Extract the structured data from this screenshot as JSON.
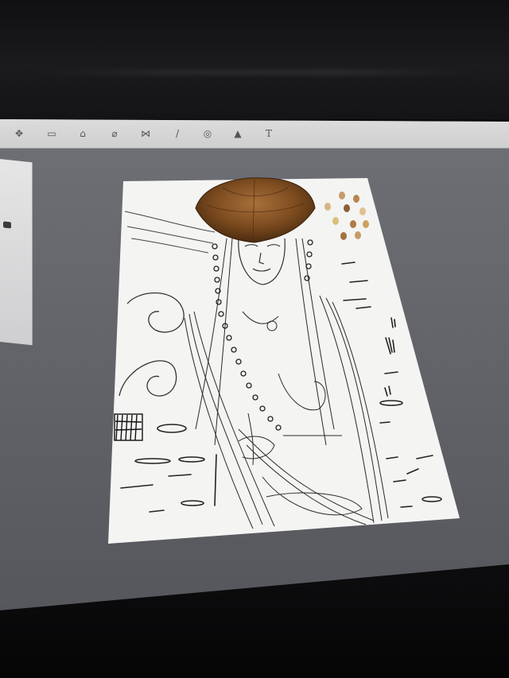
{
  "toolbar": {
    "tools": [
      {
        "name": "move-tool",
        "glyph": "✥"
      },
      {
        "name": "layer-tool",
        "glyph": "▭"
      },
      {
        "name": "shape-tool",
        "glyph": "⌂"
      },
      {
        "name": "eraser-tool",
        "glyph": "⌀"
      },
      {
        "name": "mirror-tool",
        "glyph": "⋈"
      },
      {
        "name": "brush-tool",
        "glyph": "/"
      },
      {
        "name": "fill-tool",
        "glyph": "◎"
      },
      {
        "name": "image-tool",
        "glyph": "▲"
      },
      {
        "name": "text-tool",
        "glyph": "T"
      }
    ]
  },
  "colors": {
    "headdress": "#7a4a1e",
    "swatches": [
      "#c79a6a",
      "#b98551",
      "#d7b487",
      "#8b5e3c",
      "#e0c090",
      "#b07a44",
      "#cda15e",
      "#d8c27a",
      "#a27240"
    ]
  }
}
